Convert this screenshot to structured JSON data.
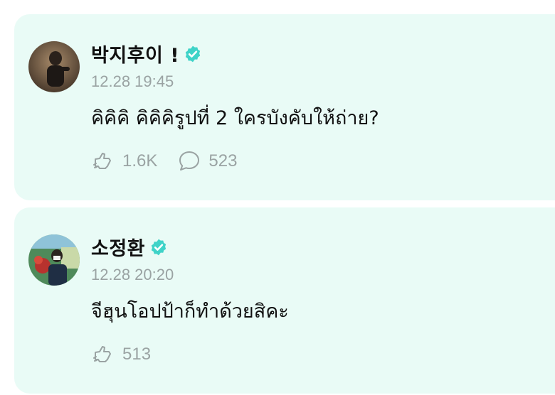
{
  "posts": [
    {
      "name": "박지후이 !",
      "time": "12.28 19:45",
      "message": "คิคิคิ คิคิคิรูปที่ 2 ใครบังคับให้ถ่าย?",
      "likes": "1.6K",
      "comments": "523"
    },
    {
      "name": "소정환",
      "time": "12.28 20:20",
      "message": "จีฮุนโอปป้าก็ทำด้วยสิคะ",
      "likes": "513"
    }
  ],
  "colors": {
    "card_bg": "#e9fbf6",
    "verified": "#3fd3c8",
    "muted": "#9aa3a3"
  },
  "icons": [
    "verified-badge-icon",
    "like-icon",
    "comment-icon"
  ]
}
